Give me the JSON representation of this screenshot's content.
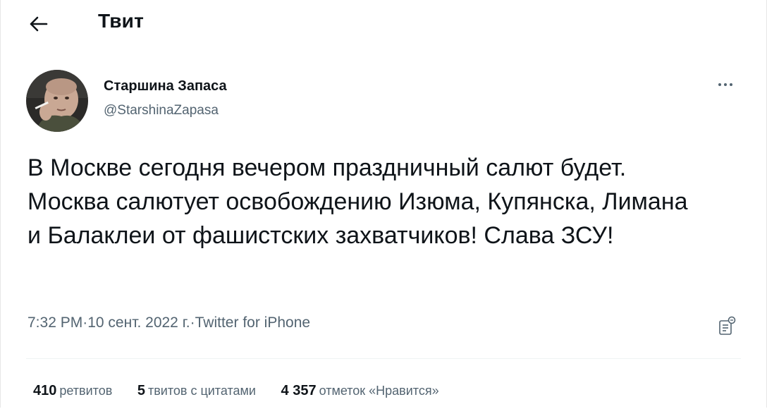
{
  "header": {
    "title": "Твит",
    "back_icon": "arrow-left-icon"
  },
  "author": {
    "name": "Старшина Запаса",
    "handle": "@StarshinaZapasa",
    "avatar": "user-avatar-photo"
  },
  "tweet": {
    "text": "В Москве сегодня вечером праздничный салют будет. Москва салютует освобождению Изюма, Купянска, Лимана и Балаклеи от фашистских захватчиков! Слава ЗСУ!"
  },
  "meta": {
    "time": "7:32 PM",
    "sep1": " · ",
    "date": "10 сент. 2022 г.",
    "sep2": " · ",
    "source": "Twitter for iPhone"
  },
  "stats": [
    {
      "count": "410",
      "label": "ретвитов"
    },
    {
      "count": "5",
      "label": "твитов с цитатами"
    },
    {
      "count": "4 357",
      "label": "отметок «Нравится»"
    }
  ],
  "icons": {
    "more": "more-horizontal-icon",
    "analytics": "tweet-analytics-icon"
  },
  "colors": {
    "text_primary": "#0f1419",
    "text_secondary": "#536471",
    "divider": "#eff3f4"
  }
}
